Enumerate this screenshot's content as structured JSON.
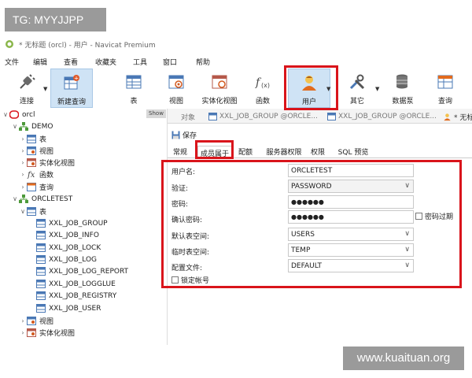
{
  "watermark": {
    "top": "TG: MYYJJPP",
    "bottom": "www.kuaituan.org"
  },
  "window": {
    "title": "* 无标题 (orcl) - 用户 - Navicat Premium"
  },
  "menu": [
    "文件",
    "编辑",
    "查看",
    "收藏夹",
    "工具",
    "窗口",
    "帮助"
  ],
  "toolbar": {
    "connect": "连接",
    "new_query": "新建查询",
    "table": "表",
    "view": "视图",
    "mview": "实体化视图",
    "function": "函数",
    "user": "用户",
    "other": "其它",
    "datasource": "数据泵",
    "query": "查询"
  },
  "tree": {
    "show_label": "Show",
    "root": "orcl",
    "demo": {
      "name": "DEMO",
      "children": [
        "表",
        "视图",
        "实体化视图",
        "函数",
        "查询"
      ]
    },
    "orcletest": {
      "name": "ORCLETEST",
      "table_group": "表",
      "tables": [
        "XXL_JOB_GROUP",
        "XXL_JOB_INFO",
        "XXL_JOB_LOCK",
        "XXL_JOB_LOG",
        "XXL_JOB_LOG_REPORT",
        "XXL_JOB_LOGGLUE",
        "XXL_JOB_REGISTRY",
        "XXL_JOB_USER"
      ],
      "after": [
        "视图",
        "实体化视图"
      ]
    }
  },
  "tabs": [
    "对象",
    "XXL_JOB_GROUP @ORCLE...",
    "XXL_JOB_GROUP @ORCLE...",
    "* 无标"
  ],
  "save_label": "保存",
  "subtabs": [
    "常规",
    "成员属于",
    "配额",
    "服务器权限",
    "权限",
    "SQL 预览"
  ],
  "form": {
    "username_label": "用户名:",
    "username_value": "ORCLETEST",
    "auth_label": "验证:",
    "auth_value": "PASSWORD",
    "password_label": "密码:",
    "password_value": "●●●●●●",
    "confirm_label": "确认密码:",
    "confirm_value": "●●●●●●",
    "expire_label": "密码过期",
    "default_ts_label": "默认表空间:",
    "default_ts_value": "USERS",
    "temp_ts_label": "临时表空间:",
    "temp_ts_value": "TEMP",
    "profile_label": "配置文件:",
    "profile_value": "DEFAULT",
    "lock_label": "锁定帐号"
  },
  "colors": {
    "highlight": "#d9141b",
    "active_tool": "#cfe3f5",
    "accent": "#2b7bd3"
  }
}
